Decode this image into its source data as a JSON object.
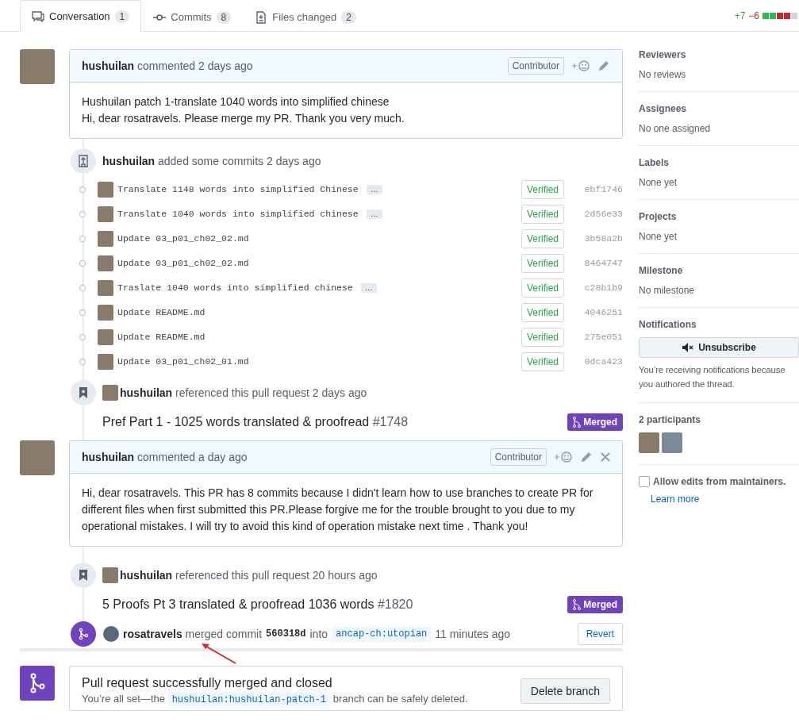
{
  "tabs": [
    {
      "label": "Conversation",
      "count": "1",
      "selected": true
    },
    {
      "label": "Commits",
      "count": "8",
      "selected": false
    },
    {
      "label": "Files changed",
      "count": "2",
      "selected": false
    }
  ],
  "diffstat": {
    "added": "+7",
    "removed": "−6",
    "blocks": [
      {
        "color": "#2cbe4e"
      },
      {
        "color": "#2cbe4e"
      },
      {
        "color": "#cb2431"
      },
      {
        "color": "#cb2431"
      },
      {
        "color": "#d1d5da"
      }
    ]
  },
  "timeline": [
    {
      "kind": "comment",
      "author": "hushuilan",
      "action": "commented 2 days ago",
      "role": "Contributor",
      "can_delete": false,
      "body": [
        "Hushuilan patch 1-translate 1040 words into simplified chinese",
        "Hi, dear rosatravels. Please merge my PR. Thank you very much."
      ]
    },
    {
      "kind": "commits",
      "author": "hushuilan",
      "action": "added some commits 2 days ago",
      "commits": [
        {
          "message": "Translate 1148 words into simplified Chinese",
          "more": "…",
          "verified": "Verified",
          "sha": "ebf1746"
        },
        {
          "message": "Translate 1040 words into simplified chinese",
          "more": "…",
          "verified": "Verified",
          "sha": "2d56e33"
        },
        {
          "message": "Update 03_p01_ch02_02.md",
          "verified": "Verified",
          "sha": "3b58a2b"
        },
        {
          "message": "Update 03_p01_ch02_02.md",
          "verified": "Verified",
          "sha": "8464747"
        },
        {
          "message": "Traslate 1040 words into simplified chinese",
          "more": "…",
          "verified": "Verified",
          "sha": "c28b1b9"
        },
        {
          "message": "Update README.md",
          "verified": "Verified",
          "sha": "4046251"
        },
        {
          "message": "Update README.md",
          "verified": "Verified",
          "sha": "275e051"
        },
        {
          "message": "Update 03_p01_ch02_01.md",
          "verified": "Verified",
          "sha": "0dca423"
        }
      ]
    },
    {
      "kind": "reference",
      "author": "hushuilan",
      "action": "referenced this pull request 2 days ago",
      "title": "Pref Part 1 - 1025 words translated & proofread",
      "number": "#1748",
      "state": "Merged"
    },
    {
      "kind": "comment",
      "author": "hushuilan",
      "action": "commented a day ago",
      "role": "Contributor",
      "can_delete": true,
      "body": [
        "Hi, dear rosatravels. This PR has 8 commits because I didn't learn how to use branches to create PR for different files when first submitted this PR.Please forgive me for the trouble brought to you due to my operational mistakes. I will try to avoid this kind of operation mistake next time . Thank you!"
      ]
    },
    {
      "kind": "reference",
      "author": "hushuilan",
      "action": "referenced this pull request 20 hours ago",
      "title": "5 Proofs Pt 3 translated & proofread 1036 words",
      "number": "#1820",
      "state": "Merged"
    },
    {
      "kind": "merge",
      "author": "rosatravels",
      "action": "merged commit",
      "commit": "560318d",
      "into": "into",
      "branch": "ancap-ch:utopian",
      "time": "11 minutes ago",
      "button": "Revert"
    }
  ],
  "merge_status": {
    "title": "Pull request successfully merged and closed",
    "text_before": "You’re all set—the",
    "branch": "hushuilan:hushuilan-patch-1",
    "text_after": "branch can be safely deleted.",
    "button": "Delete branch"
  },
  "sidebar": {
    "sections": [
      {
        "title": "Reviewers",
        "value": "No reviews"
      },
      {
        "title": "Assignees",
        "value": "No one assigned"
      },
      {
        "title": "Labels",
        "value": "None yet"
      },
      {
        "title": "Projects",
        "value": "None yet"
      },
      {
        "title": "Milestone",
        "value": "No milestone"
      }
    ],
    "notifications": {
      "title": "Notifications",
      "button": "Unsubscribe",
      "note": "You’re receiving notifications because you authored the thread."
    },
    "participants": {
      "title": "2 participants"
    },
    "allow_edits": {
      "label": "Allow edits from maintainers.",
      "checked": false,
      "link": "Learn more"
    }
  }
}
